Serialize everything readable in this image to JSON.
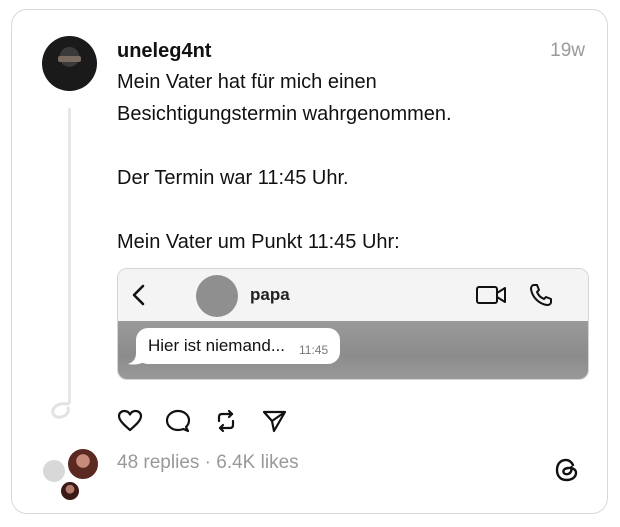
{
  "post": {
    "username": "uneleg4nt",
    "time": "19w",
    "lines": [
      "Mein Vater hat für mich einen",
      "Besichtigungstermin wahrgenommen.",
      "Der Termin war 11:45 Uhr.",
      "Mein Vater um Punkt 11:45 Uhr:"
    ]
  },
  "embed": {
    "contact_name": "papa",
    "message": "Hier ist niemand...",
    "message_time": "11:45",
    "icons": [
      "back-arrow-icon",
      "video-call-icon",
      "phone-icon"
    ]
  },
  "actions": [
    "heart-icon",
    "comment-icon",
    "repost-icon",
    "share-icon"
  ],
  "footer": {
    "stats": "48 replies · 6.4K likes",
    "logo": "threads-logo-icon"
  }
}
